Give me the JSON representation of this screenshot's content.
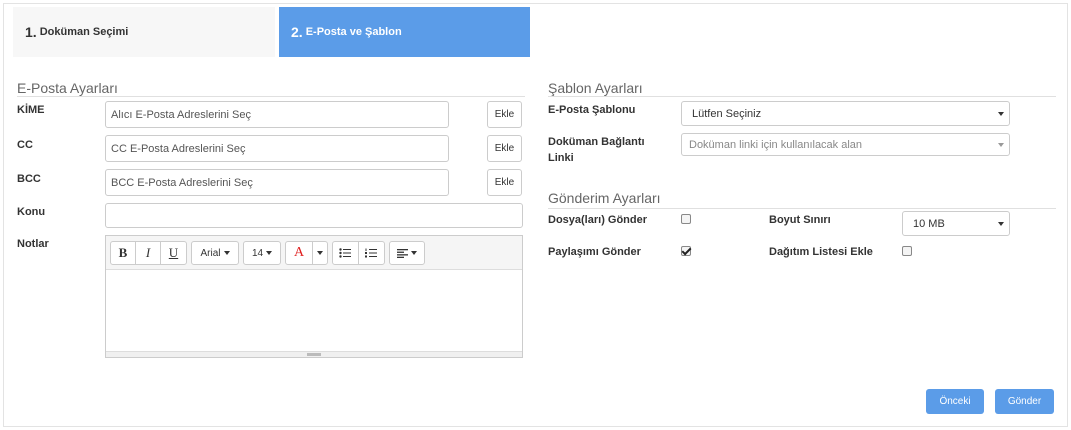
{
  "tabs": [
    {
      "number": "1.",
      "label": "Doküman Seçimi"
    },
    {
      "number": "2.",
      "label": "E-Posta ve Şablon"
    }
  ],
  "email_settings": {
    "title": "E-Posta Ayarları",
    "to": {
      "label": "KİME",
      "placeholder": "Alıcı E-Posta Adreslerini Seç",
      "add_label": "Ekle"
    },
    "cc": {
      "label": "CC",
      "placeholder": "CC E-Posta Adreslerini Seç",
      "add_label": "Ekle"
    },
    "bcc": {
      "label": "BCC",
      "placeholder": "BCC E-Posta Adreslerini Seç",
      "add_label": "Ekle"
    },
    "subject": {
      "label": "Konu",
      "value": ""
    },
    "notes": {
      "label": "Notlar",
      "toolbar": {
        "bold": "B",
        "italic": "I",
        "underline": "U",
        "font_family": "Arial",
        "font_size": "14",
        "font_color": "A",
        "font_color_value": "#e02020",
        "bullet_list_icon": "bullet-list-icon",
        "numbered_list_icon": "numbered-list-icon",
        "align_icon": "align-left-icon"
      },
      "content": ""
    }
  },
  "template_settings": {
    "title": "Şablon Ayarları",
    "template": {
      "label": "E-Posta Şablonu",
      "selected": "Lütfen Seçiniz"
    },
    "doc_link": {
      "label_line1": "Doküman Bağlantı",
      "label_line2": "Linki",
      "placeholder": "Doküman linki için kullanılacak alan"
    }
  },
  "send_settings": {
    "title": "Gönderim Ayarları",
    "send_files": {
      "label": "Dosya(ları) Gönder",
      "checked": false
    },
    "size_limit": {
      "label": "Boyut Sınırı",
      "selected": "10 MB"
    },
    "send_share": {
      "label": "Paylaşımı Gönder",
      "checked": true
    },
    "add_dist_list": {
      "label": "Dağıtım Listesi Ekle",
      "checked": false
    }
  },
  "footer": {
    "prev_label": "Önceki",
    "send_label": "Gönder"
  },
  "colors": {
    "accent": "#5b9ce8",
    "tab_inactive": "#f7f7f7"
  }
}
